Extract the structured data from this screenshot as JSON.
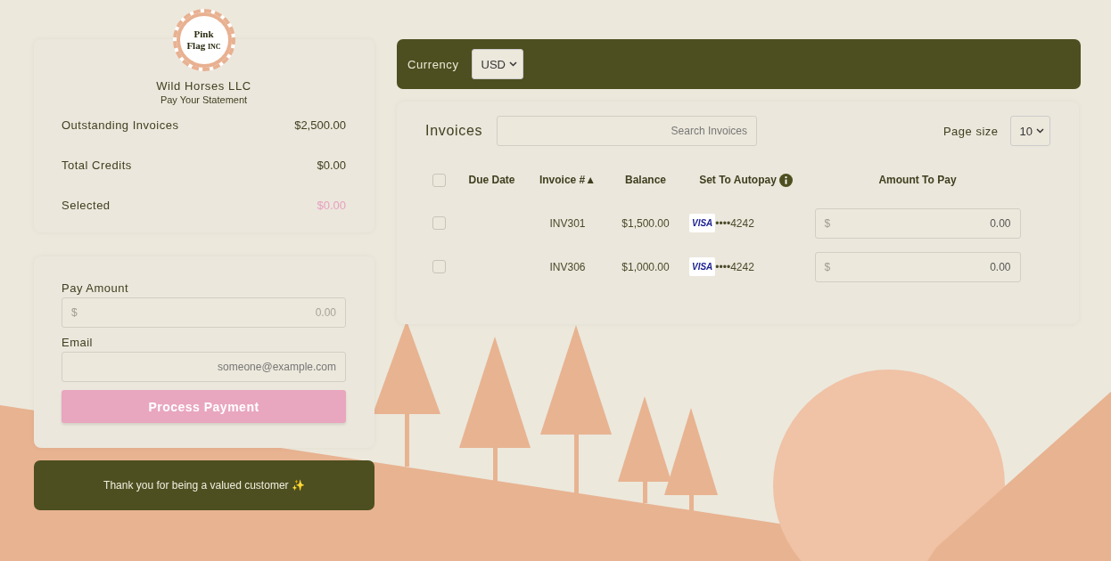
{
  "logo": {
    "line_1": "Pink",
    "line_2": "Flag",
    "suffix": "INC"
  },
  "company": {
    "name": "Wild Horses LLC",
    "subtitle": "Pay Your Statement"
  },
  "summary": [
    {
      "label": "Outstanding Invoices",
      "value": "$2,500.00",
      "highlight": false
    },
    {
      "label": "Total Credits",
      "value": "$0.00",
      "highlight": false
    },
    {
      "label": "Selected",
      "value": "$0.00",
      "highlight": true
    }
  ],
  "payment_form": {
    "amount_label": "Pay Amount",
    "amount_prefix": "$",
    "amount_placeholder": "0.00",
    "email_label": "Email",
    "email_placeholder": "someone@example.com",
    "button": {
      "label": "Process Payment",
      "disabled": true
    }
  },
  "thanks": "Thank you for being a valued customer ✨",
  "currency": {
    "label": "Currency",
    "value": "USD"
  },
  "invoices": {
    "title": "Invoices",
    "search_placeholder": "Search Invoices",
    "page_size_label": "Page size",
    "page_size": "10",
    "columns": [
      {
        "kind": "checkbox",
        "checked": false
      },
      {
        "kind": "text",
        "label": "Due Date"
      },
      {
        "kind": "text",
        "label": "Invoice #▲"
      },
      {
        "kind": "text",
        "label": "Balance"
      },
      {
        "kind": "info",
        "label": "Set To Autopay"
      },
      {
        "kind": "text",
        "label": "Amount To Pay"
      }
    ],
    "rows": [
      {
        "checked": false,
        "invoice": "INV301",
        "balance": "$1,500.00",
        "card_brand": "VISA",
        "card_number": "••••4242",
        "amount_prefix": "$",
        "amount": "0.00"
      },
      {
        "checked": false,
        "invoice": "INV306",
        "balance": "$1,000.00",
        "card_brand": "VISA",
        "card_number": "••••4242",
        "amount_prefix": "$",
        "amount": "0.00"
      }
    ]
  }
}
